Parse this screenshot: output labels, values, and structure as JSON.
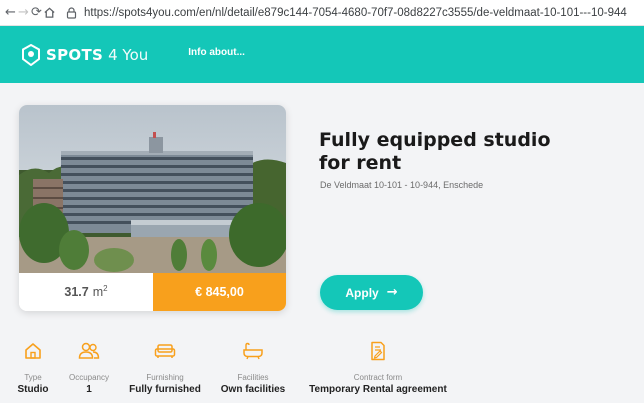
{
  "browser": {
    "url": "https://spots4you.com/en/nl/detail/e879c144-7054-4680-70f7-08d8227c3555/de-veldmaat-10-101---10-944"
  },
  "header": {
    "brand_bold": "SPOTS",
    "brand_light": "4 You",
    "nav_info": "Info about..."
  },
  "listing": {
    "title": "Fully equipped studio for rent",
    "address": "De Veldmaat 10-101 - 10-944, Enschede",
    "area_value": "31.7",
    "area_unit": "m",
    "area_sup": "2",
    "rent": "€ 845,00",
    "apply_label": "Apply"
  },
  "features": [
    {
      "icon": "house-icon",
      "label": "Type",
      "value": "Studio"
    },
    {
      "icon": "people-icon",
      "label": "Occupancy",
      "value": "1"
    },
    {
      "icon": "sofa-icon",
      "label": "Furnishing",
      "value": "Fully furnished"
    },
    {
      "icon": "bathtub-icon",
      "label": "Facilities",
      "value": "Own facilities"
    },
    {
      "icon": "contract-icon",
      "label": "Contract form",
      "value": "Temporary Rental agreement"
    }
  ],
  "colors": {
    "brand": "#14c7b8",
    "accent": "#f8a01c"
  }
}
